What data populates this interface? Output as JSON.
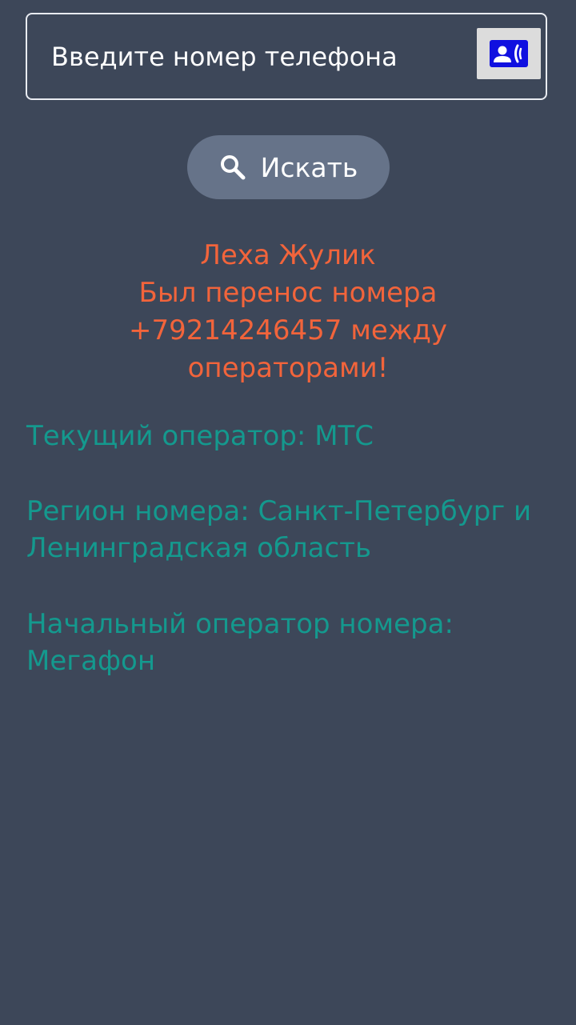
{
  "phone_input": {
    "placeholder": "Введите номер телефона",
    "value": ""
  },
  "contacts_button": {
    "icon": "contact-phone-icon",
    "icon_color": "#1010e0"
  },
  "search_button": {
    "icon": "search-icon",
    "label": "Искать"
  },
  "result": {
    "warning_lines": [
      "Леха Жулик",
      "Был перенос номера",
      "+79214246457 между",
      "операторами!"
    ],
    "current_operator": "Текущий оператор: МТС",
    "region": "Регион номера: Санкт-Петербург и Ленинградская область",
    "original_operator": "Начальный оператор номера: Мегафон"
  },
  "colors": {
    "background": "#3d4759",
    "warning": "#f2643b",
    "info": "#14998e",
    "search_button": "#667389"
  }
}
